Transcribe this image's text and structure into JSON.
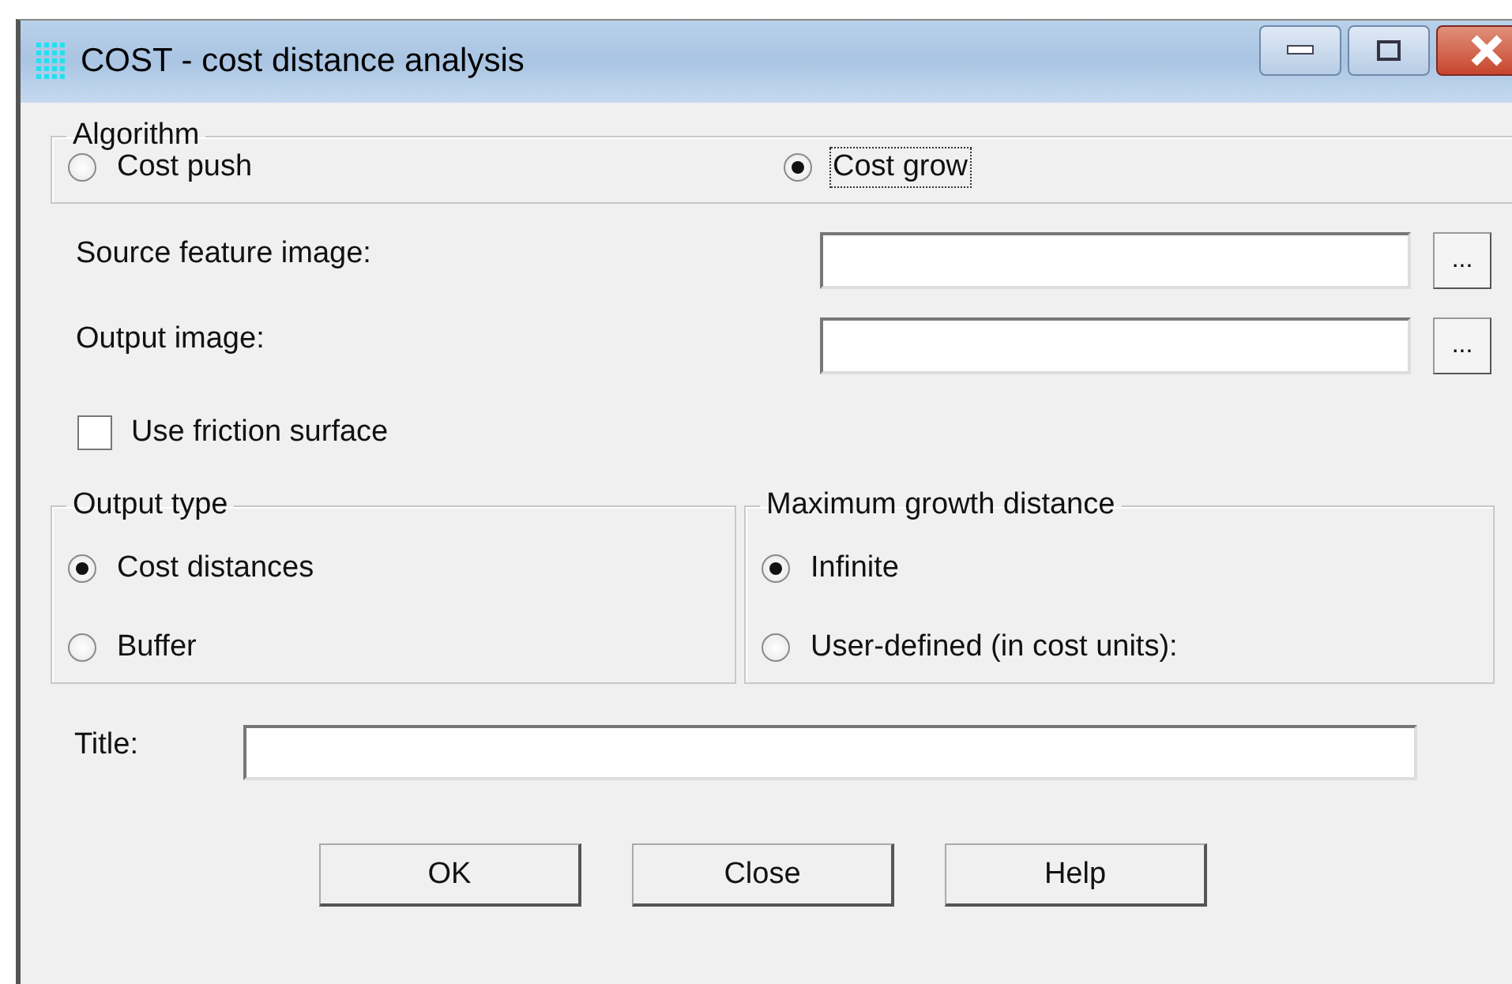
{
  "window": {
    "title": "COST - cost distance analysis"
  },
  "algorithm": {
    "label": "Algorithm",
    "options": [
      {
        "label": "Cost push",
        "selected": false,
        "focused": false
      },
      {
        "label": "Cost grow",
        "selected": true,
        "focused": true
      }
    ]
  },
  "fields": [
    {
      "label": "Source feature image:",
      "browse": "..."
    },
    {
      "label": "Output image:",
      "browse": "..."
    }
  ],
  "friction": {
    "label": "Use friction surface",
    "checked": false
  },
  "groups": [
    {
      "label": "Output type",
      "options": [
        {
          "label": "Cost distances",
          "selected": true
        },
        {
          "label": "Buffer",
          "selected": false
        }
      ]
    },
    {
      "label": "Maximum growth distance",
      "options": [
        {
          "label": "Infinite",
          "selected": true
        },
        {
          "label": "User-defined (in cost units):",
          "selected": false
        }
      ]
    }
  ],
  "title_field": {
    "label": "Title:"
  },
  "buttons": [
    "OK",
    "Close",
    "Help"
  ]
}
